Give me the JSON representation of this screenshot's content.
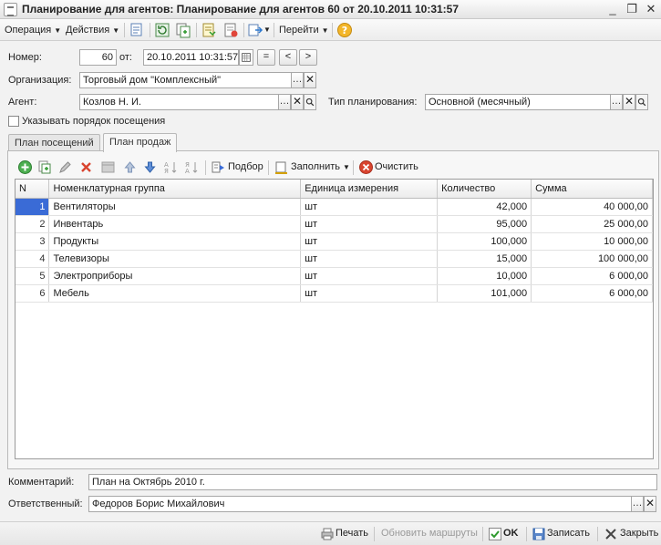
{
  "window": {
    "title": "Планирование для агентов: Планирование для агентов 60 от 20.10.2011 10:31:57"
  },
  "commandbar": {
    "operation": "Операция",
    "actions": "Действия",
    "goto": "Перейти"
  },
  "form": {
    "number_label": "Номер:",
    "number_value": "60",
    "date_label": "от:",
    "date_value": "20.10.2011 10:31:57",
    "org_label": "Организация:",
    "org_value": "Торговый дом \"Комплексный\"",
    "agent_label": "Агент:",
    "agent_value": "Козлов Н. И.",
    "plan_type_label": "Тип планирования:",
    "plan_type_value": "Основной (месячный)",
    "visit_order_label": "Указывать порядок посещения",
    "visit_order_checked": false
  },
  "tabs": [
    {
      "label": "План посещений",
      "active": false
    },
    {
      "label": "План продаж",
      "active": true
    }
  ],
  "grid_toolbar": {
    "pick": "Подбор",
    "fill": "Заполнить",
    "clear": "Очистить"
  },
  "table": {
    "columns": [
      "N",
      "Номенклатурная группа",
      "Единица измерения",
      "Количество",
      "Сумма"
    ],
    "rows": [
      {
        "n": "1",
        "group": "Вентиляторы",
        "unit": "шт",
        "qty": "42,000",
        "sum": "40 000,00"
      },
      {
        "n": "2",
        "group": "Инвентарь",
        "unit": "шт",
        "qty": "95,000",
        "sum": "25 000,00"
      },
      {
        "n": "3",
        "group": "Продукты",
        "unit": "шт",
        "qty": "100,000",
        "sum": "10 000,00"
      },
      {
        "n": "4",
        "group": "Телевизоры",
        "unit": "шт",
        "qty": "15,000",
        "sum": "100 000,00"
      },
      {
        "n": "5",
        "group": "Электроприборы",
        "unit": "шт",
        "qty": "10,000",
        "sum": "6 000,00"
      },
      {
        "n": "6",
        "group": "Мебель",
        "unit": "шт",
        "qty": "101,000",
        "sum": "6 000,00"
      }
    ],
    "selected_row": 0
  },
  "footer_fields": {
    "comment_label": "Комментарий:",
    "comment_value": "План на Октябрь 2010 г.",
    "responsible_label": "Ответственный:",
    "responsible_value": "Федоров Борис Михайлович"
  },
  "bottombar": {
    "print": "Печать",
    "update_routes": "Обновить маршруты",
    "ok": "OK",
    "save": "Записать",
    "close": "Закрыть"
  },
  "colors": {
    "accent_selection": "#3a6bd6",
    "clear_icon": "#d9442f",
    "ok_icon": "#2e9a2e"
  }
}
